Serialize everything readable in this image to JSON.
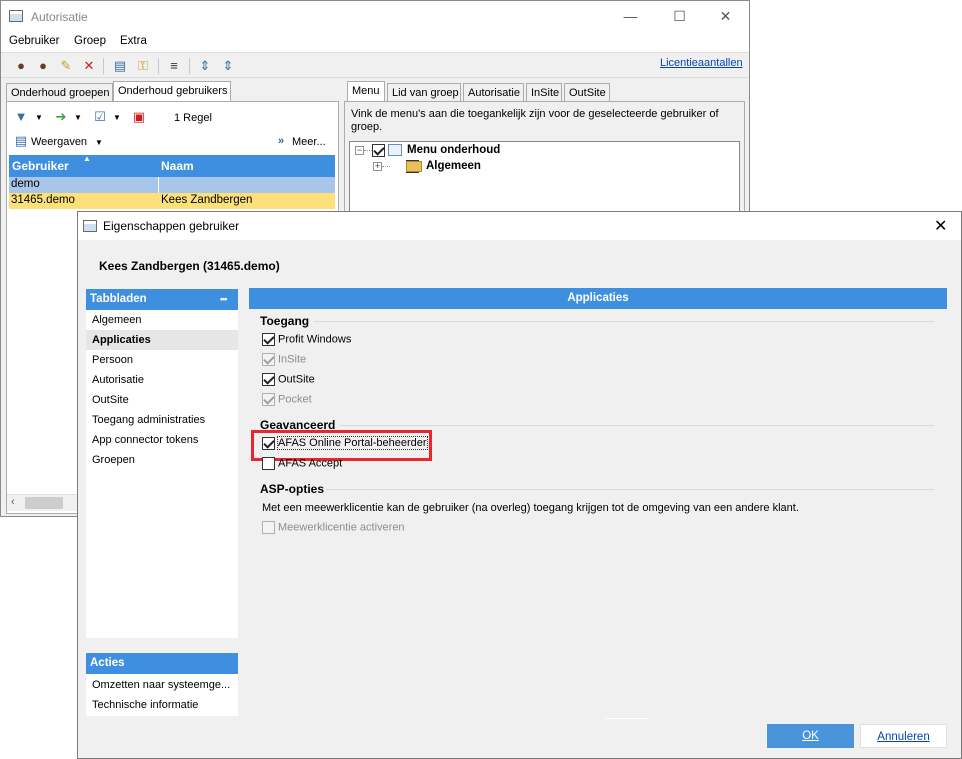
{
  "bgwindow": {
    "title": "Autorisatie",
    "menu": [
      "Gebruiker",
      "Groep",
      "Extra"
    ],
    "license_link": "Licentieaantallen",
    "left_tabs": [
      "Onderhoud groepen",
      "Onderhoud gebruikers"
    ],
    "row_count": "1 Regel",
    "weergaven": "Weergaven",
    "meer": "Meer...",
    "grid": {
      "columns": [
        "Gebruiker",
        "Naam"
      ],
      "rows": [
        {
          "user": "demo",
          "name": ""
        },
        {
          "user": "31465.demo",
          "name": "Kees Zandbergen"
        }
      ]
    },
    "right_tabs": [
      "Menu",
      "Lid van groep",
      "Autorisatie",
      "InSite",
      "OutSite"
    ],
    "info_text": "Vink de menu's aan die toegankelijk zijn voor de geselecteerde gebruiker of groep.",
    "tree": [
      "Menu onderhoud",
      "Algemeen"
    ]
  },
  "dialog": {
    "title": "Eigenschappen gebruiker",
    "user_heading": "Kees Zandbergen (31465.demo)",
    "tabbladen_title": "Tabbladen",
    "tabbladen_more": "•••",
    "tabbladen": [
      "Algemeen",
      "Applicaties",
      "Persoon",
      "Autorisatie",
      "OutSite",
      "Toegang administraties",
      "App connector tokens",
      "Groepen"
    ],
    "acties_title": "Acties",
    "acties": [
      "Omzetten naar systeemge...",
      "Technische informatie"
    ],
    "panel_title": "Applicaties",
    "toegang_title": "Toegang",
    "toegang": [
      {
        "label": "Profit Windows",
        "checked": true,
        "enabled": true
      },
      {
        "label": "InSite",
        "checked": true,
        "enabled": false
      },
      {
        "label": "OutSite",
        "checked": true,
        "enabled": true
      },
      {
        "label": "Pocket",
        "checked": true,
        "enabled": false
      }
    ],
    "geavanceerd_title": "Geavanceerd",
    "geavanceerd": [
      {
        "label": "AFAS Online Portal-beheerder",
        "checked": true
      },
      {
        "label": "AFAS Accept",
        "checked": false
      }
    ],
    "asp_title": "ASP-opties",
    "asp_text": "Met een meewerklicentie kan de gebruiker (na overleg) toegang krijgen tot de omgeving van een andere klant.",
    "asp_option": "Meewerklicentie activeren",
    "ok_label": "OK",
    "cancel_label": "Annuleren",
    "highlight_color": "#e8262d",
    "accent_color": "#3f8fe0"
  }
}
